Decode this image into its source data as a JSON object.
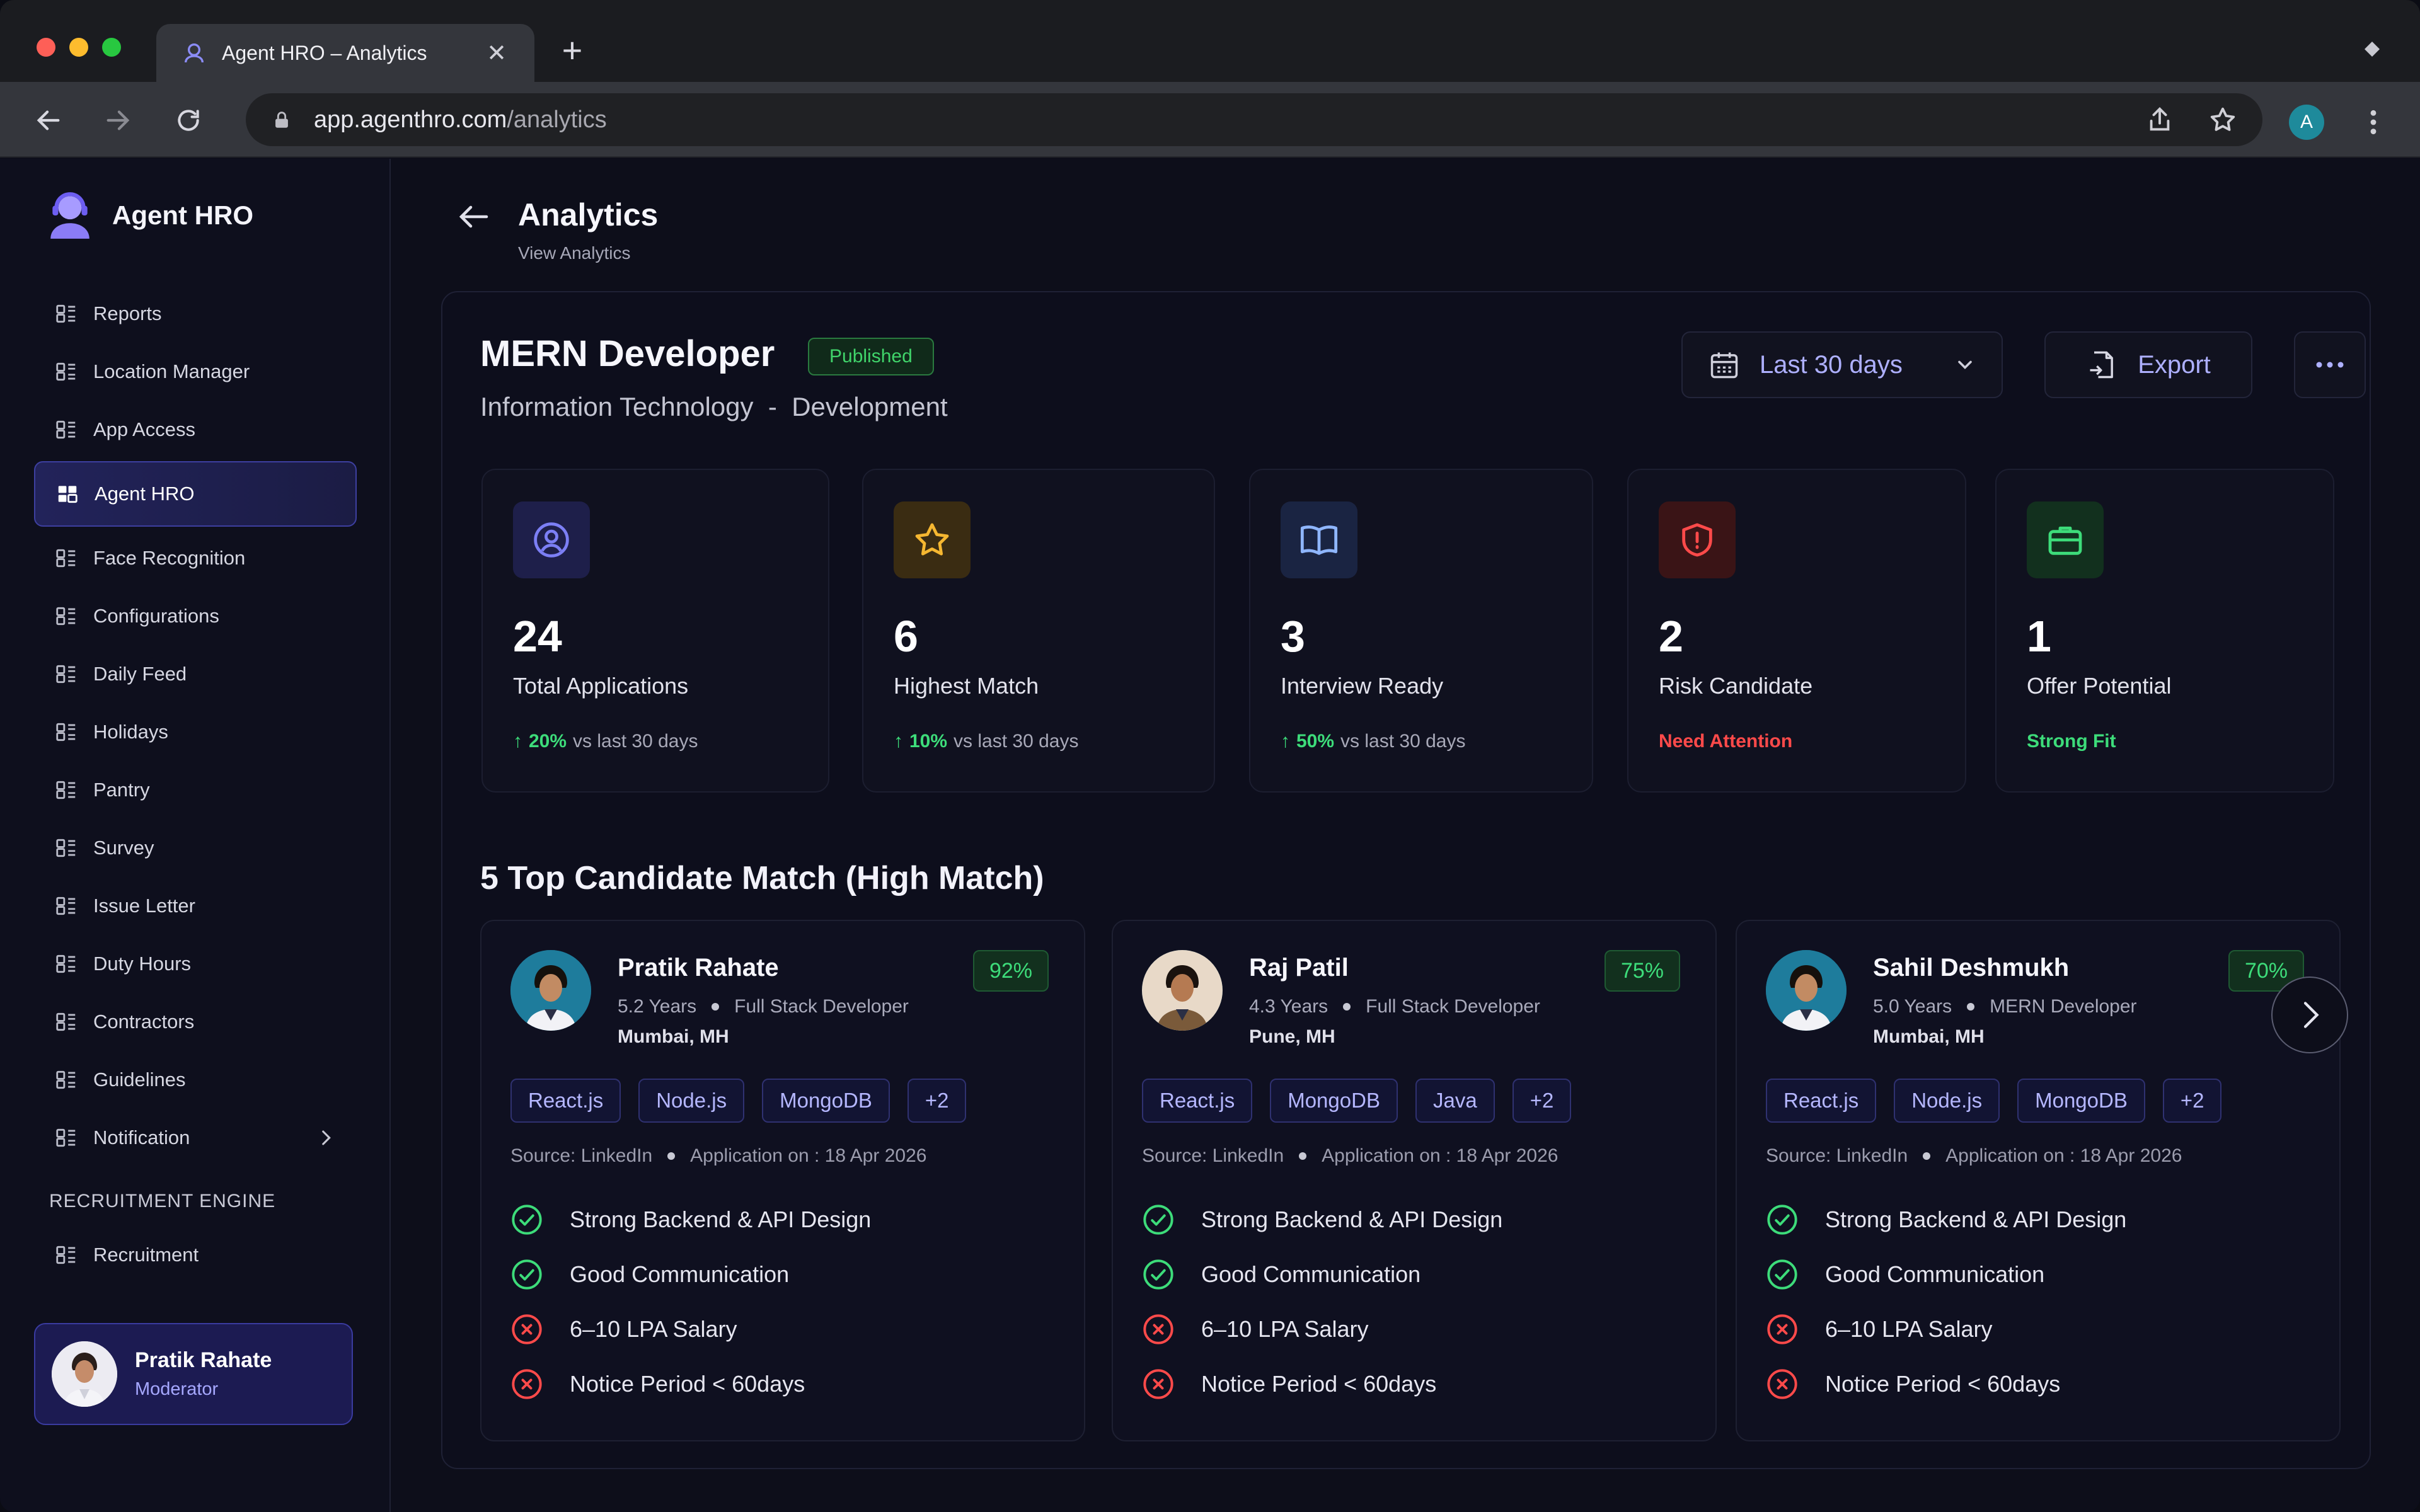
{
  "browser": {
    "tab_title": "Agent HRO – Analytics",
    "url_host": "app.agenthro.com",
    "url_path": "/analytics",
    "profile_initial": "A"
  },
  "sidebar": {
    "brand": "Agent HRO",
    "items": [
      {
        "label": "Reports"
      },
      {
        "label": "Location Manager"
      },
      {
        "label": "App Access"
      },
      {
        "label": "Agent HRO",
        "active": true
      },
      {
        "label": "Face Recognition"
      },
      {
        "label": "Configurations"
      },
      {
        "label": "Daily Feed"
      },
      {
        "label": "Holidays"
      },
      {
        "label": "Pantry"
      },
      {
        "label": "Survey"
      },
      {
        "label": "Issue Letter"
      },
      {
        "label": "Duty Hours"
      },
      {
        "label": "Contractors"
      },
      {
        "label": "Guidelines"
      },
      {
        "label": "Notification"
      }
    ],
    "section_label": "RECRUITMENT ENGINE",
    "section_items": [
      {
        "label": "Recruitment"
      }
    ],
    "user": {
      "name": "Pratik Rahate",
      "role": "Moderator"
    }
  },
  "header": {
    "title": "Analytics",
    "subtitle": "View Analytics"
  },
  "job": {
    "title": "MERN Developer",
    "status": "Published",
    "department": "Information Technology",
    "separator": "-",
    "team": "Development",
    "date_range": "Last 30 days",
    "export_label": "Export"
  },
  "stats": [
    {
      "value": "24",
      "label": "Total Applications",
      "change": "20%",
      "change_suffix": "vs last 30 days",
      "icon": "user-circle-icon",
      "accent": "#6366f1"
    },
    {
      "value": "6",
      "label": "Highest Match",
      "change": "10%",
      "change_suffix": "vs last 30 days",
      "icon": "star-icon",
      "accent": "#f5b731"
    },
    {
      "value": "3",
      "label": "Interview Ready",
      "change": "50%",
      "change_suffix": "vs last 30 days",
      "icon": "book-icon",
      "accent": "#60a5fa"
    },
    {
      "value": "2",
      "label": "Risk Candidate",
      "note": "Need Attention",
      "icon": "shield-alert-icon",
      "accent": "#ef4444"
    },
    {
      "value": "1",
      "label": "Offer Potential",
      "note": "Strong Fit",
      "icon": "briefcase-icon",
      "accent": "#22c55e"
    }
  ],
  "candidates_section": {
    "title": "5 Top Candidate Match (High Match)"
  },
  "candidates": [
    {
      "name": "Pratik Rahate",
      "experience": "5.2 Years",
      "role": "Full Stack Developer",
      "location": "Mumbai, MH",
      "match": "92%",
      "skills": [
        "React.js",
        "Node.js",
        "MongoDB",
        "+2"
      ],
      "source": "Source: LinkedIn",
      "applied": "Application on : 18 Apr 2026",
      "criteria": [
        {
          "text": "Strong Backend & API Design",
          "ok": true
        },
        {
          "text": "Good Communication",
          "ok": true
        },
        {
          "text": "6–10 LPA Salary",
          "ok": false
        },
        {
          "text": "Notice Period < 60days",
          "ok": false
        }
      ]
    },
    {
      "name": "Raj Patil",
      "experience": "4.3 Years",
      "role": "Full Stack Developer",
      "location": "Pune, MH",
      "match": "75%",
      "skills": [
        "React.js",
        "MongoDB",
        "Java",
        "+2"
      ],
      "source": "Source: LinkedIn",
      "applied": "Application on : 18 Apr 2026",
      "criteria": [
        {
          "text": "Strong Backend & API Design",
          "ok": true
        },
        {
          "text": "Good Communication",
          "ok": true
        },
        {
          "text": "6–10 LPA Salary",
          "ok": false
        },
        {
          "text": "Notice Period < 60days",
          "ok": false
        }
      ]
    },
    {
      "name": "Sahil Deshmukh",
      "experience": "5.0 Years",
      "role": "MERN Developer",
      "location": "Mumbai, MH",
      "match": "70%",
      "skills": [
        "React.js",
        "Node.js",
        "MongoDB",
        "+2"
      ],
      "source": "Source: LinkedIn",
      "applied": "Application on : 18 Apr 2026",
      "criteria": [
        {
          "text": "Strong Backend & API Design",
          "ok": true
        },
        {
          "text": "Good Communication",
          "ok": true
        },
        {
          "text": "6–10 LPA Salary",
          "ok": false
        },
        {
          "text": "Notice Period < 60days",
          "ok": false
        }
      ]
    }
  ]
}
